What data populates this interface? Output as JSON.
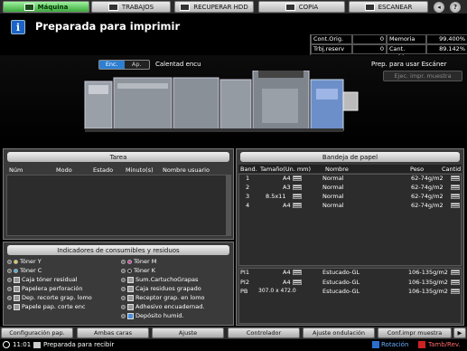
{
  "tabs": [
    {
      "label": "Máquina",
      "icon": "machine-icon",
      "active": true
    },
    {
      "label": "TRABAJOS",
      "icon": "jobs-icon",
      "active": false
    },
    {
      "label": "RECUPERAR HDD",
      "icon": "hdd-icon",
      "active": false
    },
    {
      "label": "COPIA",
      "icon": "copy-icon",
      "active": false
    },
    {
      "label": "ESCANEAR",
      "icon": "scan-icon",
      "active": false
    }
  ],
  "header": {
    "status": "Preparada para imprimir",
    "counters": [
      {
        "label": "Cont.Orig.",
        "value": "0",
        "label2": "Memoria",
        "value2": "99.400%"
      },
      {
        "label": "Trbj.reserv",
        "value": "0",
        "label2": "Cant. archiv.",
        "value2": "89.142%"
      }
    ]
  },
  "machine": {
    "enc_label": "Enc.",
    "ap_label": "Ap.",
    "warmup": "Calentad encu",
    "scanner_status": "Prep. para usar Escáner",
    "sample_button": "Ejec. impr. muestra"
  },
  "task": {
    "title": "Tarea",
    "columns": [
      "Núm",
      "Modo",
      "Estado",
      "Minuto(s)",
      "Nombre usuario"
    ]
  },
  "trays": {
    "title": "Bandeja de papel",
    "columns": [
      "Band.",
      "Tamaño(Un. mm)",
      "Nombre",
      "Peso",
      "Cantid"
    ],
    "rows": [
      {
        "tray": "1",
        "size": "A4",
        "name": "Normal",
        "weight": "62-74g/m2"
      },
      {
        "tray": "2",
        "size": "A3",
        "name": "Normal",
        "weight": "62-74g/m2"
      },
      {
        "tray": "3",
        "size": "8.5x11",
        "name": "Normal",
        "weight": "62-74g/m2"
      },
      {
        "tray": "4",
        "size": "A4",
        "name": "Normal",
        "weight": "62-74g/m2"
      }
    ],
    "extra_rows": [
      {
        "tray": "PI1",
        "size": "A4",
        "name": "Estucado-GL",
        "weight": "106-135g/m2"
      },
      {
        "tray": "PI2",
        "size": "A4",
        "name": "Estucado-GL",
        "weight": "106-135g/m2"
      },
      {
        "tray": "PB",
        "size": "307.0 x 472.0",
        "name": "Estucado-GL",
        "weight": "106-135g/m2"
      }
    ]
  },
  "consumables": {
    "title": "Indicadores de consumibles y residuos",
    "left": [
      "Tóner Y",
      "Tóner C",
      "Caja tóner residual",
      "Papelera perforación",
      "Dep. recorte grap. lomo",
      "Papele pap. corte enc"
    ],
    "right": [
      "Tóner M",
      "Tóner K",
      "Sum.CartuchoGrapas",
      "Caja residuos grapado",
      "Receptor grap. en lomo",
      "Adhesivo encuadernad.",
      "Depósito humid."
    ]
  },
  "bottom_buttons": [
    "Configuración pap.",
    "Ambas caras",
    "Ajuste",
    "Controlador",
    "Ajuste ondulación",
    "Conf.impr muestra"
  ],
  "statusbar": {
    "time": "11:01",
    "message": "Preparada para recibir",
    "rotation": "Rotación",
    "tamb": "Tamb/Rev."
  }
}
